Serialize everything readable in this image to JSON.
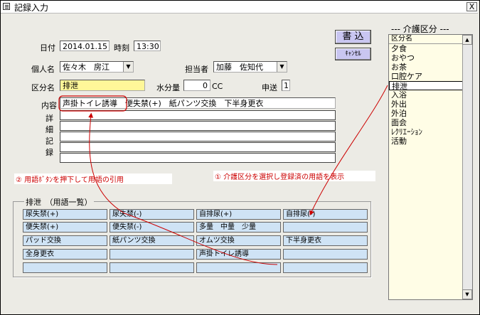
{
  "window": {
    "title": "記録入力",
    "close_label": "X"
  },
  "form": {
    "date_label": "日付",
    "date_value": "2014.01.15",
    "time_label": "時刻",
    "time_value": "13:30",
    "write_button": "書 込",
    "cancel_button": "ｷｬﾝｾﾙ",
    "resident_label": "個人名",
    "resident_value": "佐々木　房江",
    "staff_label": "担当者",
    "staff_value": "加藤　佐知代",
    "category_label": "区分名",
    "category_value": "排泄",
    "water_label": "水分量",
    "water_value": "0",
    "water_unit": "CC",
    "report_label": "申送",
    "report_value": "1",
    "content_label": "内容",
    "content_value": "声掛トイレ誘導　便失禁(+)　紙パンツ交換　下半身更衣",
    "detail_label_chars": [
      "詳",
      "細",
      "記",
      "録"
    ]
  },
  "annotations": {
    "note1": "① 介護区分を選択し登録済の用語を表示",
    "note2": "② 用語ﾎﾞﾀﾝを押下して用語の引用"
  },
  "terms_panel": {
    "heading": "排泄　（用語一覧）",
    "rows": [
      [
        "尿失禁(+)",
        "尿失禁(-)",
        "自排尿(+)",
        "自排尿(-)"
      ],
      [
        "便失禁(+)",
        "便失禁(-)",
        "多量　中量　少量",
        ""
      ],
      [
        "パッド交換",
        "紙パンツ交換",
        "オムツ交換",
        "下半身更衣"
      ],
      [
        "全身更衣",
        "",
        "声掛トイレ誘導",
        ""
      ],
      [
        "",
        "",
        "",
        ""
      ]
    ]
  },
  "category_list": {
    "title": "--- 介護区分 ---",
    "header": "区分名",
    "items": [
      "夕食",
      "おやつ",
      "お茶",
      "口腔ケア",
      "排泄",
      "入浴",
      "外出",
      "外泊",
      "面会",
      "ﾚｸﾘｴｰｼｮﾝ",
      "活動"
    ],
    "selected": "排泄"
  },
  "colors": {
    "window_bg": "#ecebe5",
    "term_button": "#cfe3f5",
    "action_button": "#c9c6f1",
    "highlight_field": "#fff799",
    "list_bg": "#fffde6",
    "annotation": "#cc0000"
  },
  "icons": {
    "title": "form-icon",
    "combo": "chevron-down-icon",
    "scroll_up": "arrow-up-icon",
    "scroll_down": "arrow-down-icon"
  }
}
